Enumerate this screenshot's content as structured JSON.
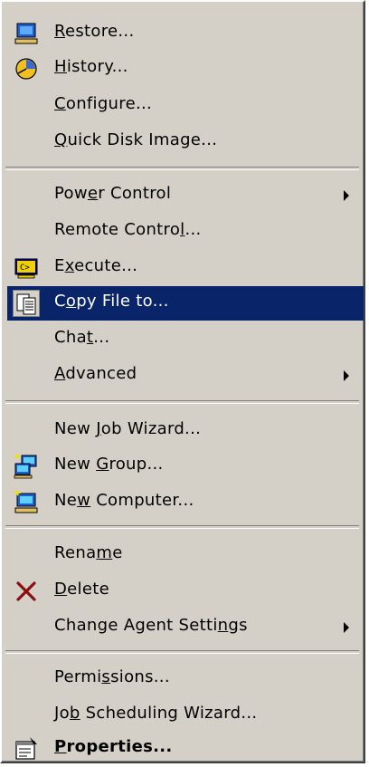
{
  "menu": {
    "items": [
      {
        "label_pre": "",
        "label_ul": "R",
        "label_post": "estore...",
        "icon": "computer-restore-icon"
      },
      {
        "label_pre": "",
        "label_ul": "H",
        "label_post": "istory...",
        "icon": "history-clock-icon"
      },
      {
        "label_pre": "",
        "label_ul": "C",
        "label_post": "onfigure...",
        "icon": ""
      },
      {
        "label_pre": "",
        "label_ul": "Q",
        "label_post": "uick Disk Image...",
        "icon": ""
      },
      {
        "label_pre": "Pow",
        "label_ul": "e",
        "label_post": "r Control",
        "icon": "",
        "submenu": true
      },
      {
        "label_pre": "Remote Contro",
        "label_ul": "l",
        "label_post": "...",
        "icon": ""
      },
      {
        "label_pre": "E",
        "label_ul": "x",
        "label_post": "ecute...",
        "icon": "execute-console-icon"
      },
      {
        "label_pre": "C",
        "label_ul": "o",
        "label_post": "py File to...",
        "icon": "copy-file-icon",
        "selected": true
      },
      {
        "label_pre": "Cha",
        "label_ul": "t",
        "label_post": "...",
        "icon": ""
      },
      {
        "label_pre": "",
        "label_ul": "A",
        "label_post": "dvanced",
        "icon": "",
        "submenu": true
      },
      {
        "label_pre": "New ",
        "label_ul": "J",
        "label_post": "ob Wizard...",
        "icon": ""
      },
      {
        "label_pre": "New ",
        "label_ul": "G",
        "label_post": "roup...",
        "icon": "new-group-icon"
      },
      {
        "label_pre": "Ne",
        "label_ul": "w",
        "label_post": " Computer...",
        "icon": "new-computer-icon"
      },
      {
        "label_pre": "Rena",
        "label_ul": "m",
        "label_post": "e",
        "icon": ""
      },
      {
        "label_pre": "",
        "label_ul": "D",
        "label_post": "elete",
        "icon": "delete-x-icon"
      },
      {
        "label_pre": "Change Agent Setti",
        "label_ul": "n",
        "label_post": "gs",
        "icon": "",
        "submenu": true
      },
      {
        "label_pre": "Permi",
        "label_ul": "s",
        "label_post": "sions...",
        "icon": ""
      },
      {
        "label_pre": "Jo",
        "label_ul": "b",
        "label_post": " Scheduling Wizard...",
        "icon": ""
      },
      {
        "label_pre": "",
        "label_ul": "P",
        "label_post": "roperties...",
        "icon": "properties-icon",
        "bold": true
      }
    ]
  }
}
